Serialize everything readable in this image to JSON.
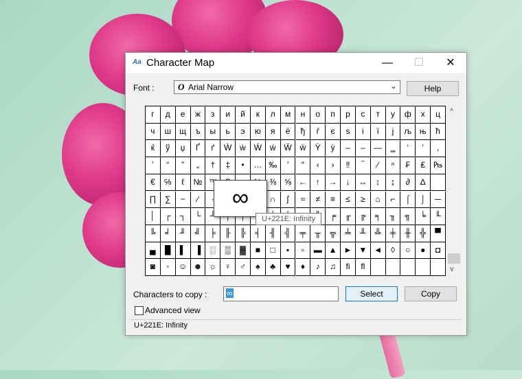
{
  "window": {
    "title": "Character Map",
    "minimize": "—",
    "maximize": "☐",
    "close": "✕"
  },
  "font": {
    "label": "Font :",
    "value": "Arial Narrow",
    "help": "Help"
  },
  "grid": {
    "rows": [
      [
        "г",
        "д",
        "е",
        "ж",
        "з",
        "и",
        "й",
        "к",
        "л",
        "м",
        "н",
        "о",
        "п",
        "р",
        "с",
        "т",
        "у",
        "ф",
        "х",
        "ц"
      ],
      [
        "ч",
        "ш",
        "щ",
        "ъ",
        "ы",
        "ь",
        "э",
        "ю",
        "я",
        "ё",
        "ђ",
        "ѓ",
        "є",
        "ѕ",
        "і",
        "ї",
        "ј",
        "љ",
        "њ",
        "ћ"
      ],
      [
        "ќ",
        "ў",
        "џ",
        "Ґ",
        "ґ",
        "Ẁ",
        "ẁ",
        "Ẃ",
        "ẃ",
        "Ẅ",
        "ẅ",
        "Ỳ",
        "ỳ",
        "‒",
        "–",
        "—",
        "‗",
        "‘",
        "’",
        "‚"
      ],
      [
        "‛",
        "“",
        "”",
        "„",
        "†",
        "‡",
        "•",
        "…",
        "‰",
        "′",
        "″",
        "‹",
        "›",
        "‼",
        "‾",
        "⁄",
        "ⁿ",
        "₣",
        "₤",
        "₧"
      ],
      [
        "€",
        "℅",
        "ℓ",
        "№",
        "™",
        "Ω",
        "℮",
        "⅓",
        "⅜",
        "⅝",
        "←",
        "↑",
        "→",
        "↓",
        "↔",
        "↕",
        "↨",
        "∂",
        "∆",
        ""
      ],
      [
        "∏",
        "∑",
        "−",
        "∕",
        "∙",
        "√",
        "∞",
        "∟",
        "∩",
        "∫",
        "≈",
        "≠",
        "≡",
        "≤",
        "≥",
        "⌂",
        "⌐",
        "⌠",
        "⌡",
        "─"
      ],
      [
        "│",
        "┌",
        "┐",
        "└",
        "┘",
        "├",
        "┤",
        "┬",
        "┴",
        "┼",
        "═",
        "║",
        "╒",
        "╓",
        "╔",
        "╕",
        "╖",
        "╗",
        "╘",
        "╙"
      ],
      [
        "╚",
        "╛",
        "╜",
        "╝",
        "╞",
        "╟",
        "╠",
        "╡",
        "╢",
        "╣",
        "╤",
        "╥",
        "╦",
        "╧",
        "╨",
        "╩",
        "╪",
        "╫",
        "╬",
        "▀"
      ],
      [
        "▄",
        "█",
        "▌",
        "▐",
        "░",
        "▒",
        "▓",
        "■",
        "□",
        "▪",
        "▫",
        "▬",
        "▲",
        "►",
        "▼",
        "◄",
        "◊",
        "○",
        "●",
        "◘"
      ],
      [
        "◙",
        "◦",
        "☺",
        "☻",
        "☼",
        "♀",
        "♂",
        "♠",
        "♣",
        "♥",
        "♦",
        "♪",
        "♫",
        "ﬁ",
        "ﬂ",
        "",
        "",
        "",
        "",
        ""
      ]
    ]
  },
  "magnifier": {
    "glyph": "∞"
  },
  "tooltip": "U+221E: Infinity",
  "copy": {
    "label": "Characters to copy :",
    "value": "∞",
    "select": "Select",
    "copy": "Copy"
  },
  "advanced": {
    "label": "Advanced view"
  },
  "status": "U+221E: Infinity",
  "scroll": {
    "up": "^",
    "down": "v"
  }
}
